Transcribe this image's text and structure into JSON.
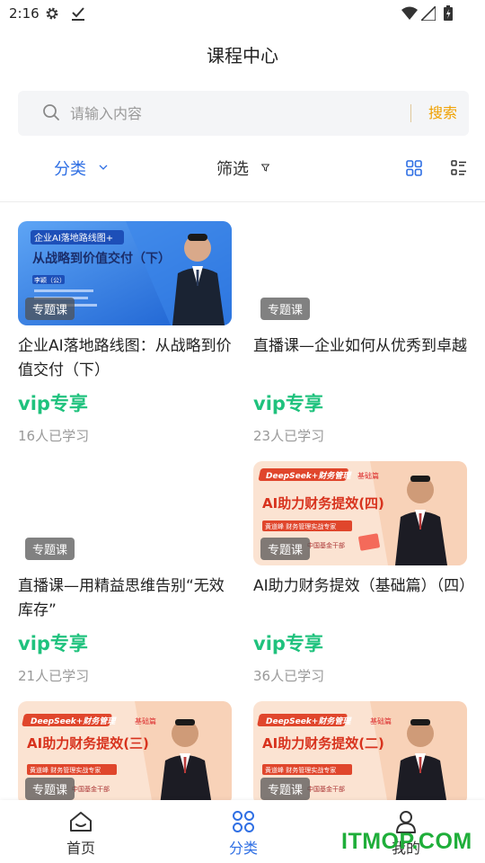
{
  "status_bar": {
    "time": "2:16"
  },
  "header": {
    "title": "课程中心"
  },
  "search": {
    "placeholder": "请输入内容",
    "button_label": "搜索"
  },
  "filters": {
    "category_label": "分类",
    "screen_label": "筛选"
  },
  "courses": [
    {
      "title": "企业AI落地路线图：从战略到价值交付（下）",
      "badge": "专题课",
      "price": "vip专享",
      "learners": "16人已学习",
      "thumb": {
        "tag": "企业AI落地路线图+",
        "headline": "从战略到价值交付（下）",
        "name": "李颖（公）"
      }
    },
    {
      "title": "直播课—企业如何从优秀到卓越",
      "badge": "专题课",
      "price": "vip专享",
      "learners": "23人已学习"
    },
    {
      "title": "直播课—用精益思维告别“无效库存”",
      "badge": "专题课",
      "price": "vip专享",
      "learners": "21人已学习"
    },
    {
      "title": "AI助力财务提效（基础篇）（四）",
      "badge": "专题课",
      "price": "vip专享",
      "learners": "36人已学习",
      "thumb": {
        "tag": "DeepSeek+财务管理",
        "sub": "基础篇",
        "headline": "AI助力财务提效(四)",
        "name": "黄道峰 财务管理实战专家",
        "org": "中国基金干部"
      }
    },
    {
      "title": "",
      "badge": "专题课",
      "thumb": {
        "tag": "DeepSeek+财务管理",
        "sub": "基础篇",
        "headline": "AI助力财务提效(三)",
        "name": "黄道峰 财务管理实战专家",
        "org": "中国基金干部"
      }
    },
    {
      "title": "",
      "badge": "专题课",
      "thumb": {
        "tag": "DeepSeek+财务管理",
        "sub": "基础篇",
        "headline": "AI助力财务提效(二)",
        "name": "黄道峰 财务管理实战专家",
        "org": "中国基金干部"
      }
    }
  ],
  "bottom_nav": [
    {
      "label": "首页",
      "icon": "home-icon"
    },
    {
      "label": "分类",
      "icon": "category-icon",
      "active": true
    },
    {
      "label": "我的",
      "icon": "profile-icon"
    }
  ],
  "watermark": "ITMOP.COM",
  "colors": {
    "accent": "#2f6fe4",
    "search_button": "#f0a100",
    "price": "#1fc27d"
  }
}
